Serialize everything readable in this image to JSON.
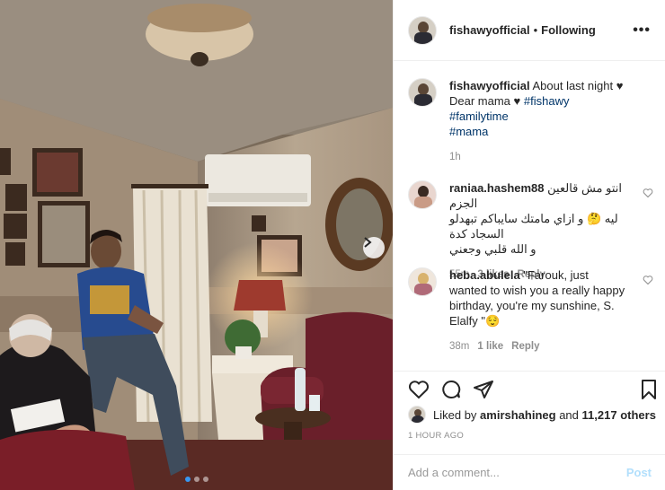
{
  "post": {
    "username": "fishawyofficial",
    "separator": "•",
    "follow_status": "Following",
    "more_icon": "more-options-icon"
  },
  "caption": {
    "username": "fishawyofficial",
    "text_before": "About last night",
    "heart": "♥",
    "text_mid": "Dear mama",
    "heart2": "♥",
    "hashtags": [
      "#fishawy",
      "#familytime",
      "#mama"
    ],
    "age": "1h"
  },
  "comments": [
    {
      "username": "raniaa.hashem88",
      "line1": "انتو مش قالعين الجزم",
      "line2": "ليه 🤔 و ازاي مامتك سايباكم تبهدلو السجاد كدة",
      "line3": "و الله قلبي وجعني",
      "age": "55m",
      "likes": "3 likes",
      "reply": "Reply"
    },
    {
      "username": "heba.abulela",
      "text": "\"Farouk, just wanted to wish you a really happy birthday, you're my sunshine, S. Elalfy \"😌",
      "age": "38m",
      "likes": "1 like",
      "reply": "Reply"
    }
  ],
  "likes": {
    "prefix": "Liked by",
    "user": "amirshahineg",
    "conj": "and",
    "others": "11,217 others"
  },
  "timestamp": "1 HOUR AGO",
  "add_comment": {
    "placeholder": "Add a comment...",
    "post_label": "Post"
  },
  "colors": {
    "link": "#003569",
    "meta": "#8e8e8e",
    "post_disabled": "#b2dffc",
    "carousel_active": "#3897f0"
  },
  "carousel": {
    "current": 1,
    "total": 3
  }
}
